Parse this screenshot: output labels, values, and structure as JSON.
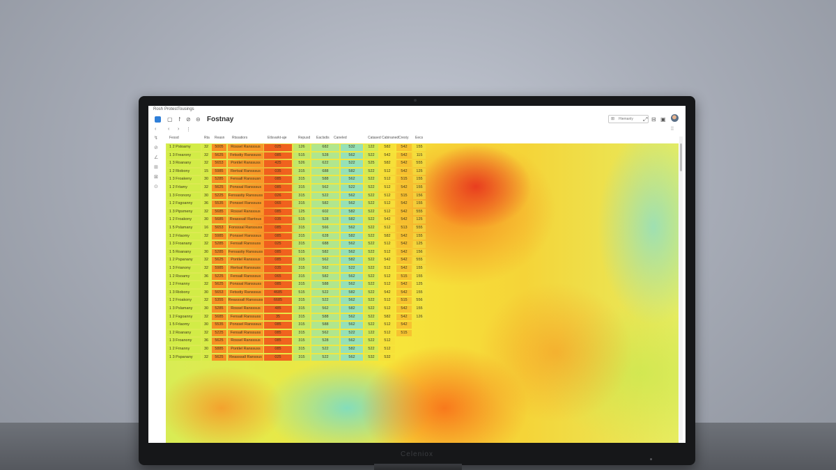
{
  "menubar": {
    "items": [
      "Rosh",
      "Protest",
      "Tousings"
    ]
  },
  "toolbar": {
    "app_title": "Fostnay",
    "search_label": "Hiemanly",
    "icons": [
      "app-icon",
      "square-icon",
      "history-icon",
      "undo-icon",
      "redo-icon",
      "grid-icon",
      "bar-icon",
      "edit-icon",
      "window-icon",
      "avatar"
    ]
  },
  "table": {
    "headers": [
      "Fessd",
      "Rta",
      "Reasn",
      "Rtssatiors",
      "Etlsvarkt-aje",
      "Repusd",
      "Eaclsdis",
      "Caneled",
      "Catased",
      "Cabinaned",
      "Cresty",
      "Eecs"
    ],
    "rows": [
      {
        "label": "1 2 Pstoamy",
        "n": "32",
        "code": "5005",
        "name": "Rossel Ransssus",
        "v": "025",
        "a": "126",
        "b": "682",
        "c": "532",
        "d": "122",
        "e": "582",
        "f": "542",
        "g": "155"
      },
      {
        "label": "1 3 Frearony",
        "n": "32",
        "code": "5625",
        "name": "Fetsstiy Ranssuss",
        "v": "085",
        "a": "515",
        "b": "528",
        "c": "562",
        "d": "522",
        "e": "542",
        "f": "542",
        "g": "115"
      },
      {
        "label": "1 3 Roanany",
        "n": "32",
        "code": "5653",
        "name": "Pontlel Ranssuss",
        "v": "425",
        "a": "526",
        "b": "622",
        "c": "522",
        "d": "525",
        "e": "582",
        "f": "542",
        "g": "555"
      },
      {
        "label": "1 2 Riobony",
        "n": "15",
        "code": "5985",
        "name": "Rertsal Ransssus",
        "v": "035",
        "a": "315",
        "b": "688",
        "c": "582",
        "d": "522",
        "e": "512",
        "f": "542",
        "g": "125"
      },
      {
        "label": "1 3 Froakeny",
        "n": "30",
        "code": "5285",
        "name": "Fensall Ranssusn",
        "v": "085",
        "a": "315",
        "b": "588",
        "c": "562",
        "d": "522",
        "e": "512",
        "f": "515",
        "g": "155"
      },
      {
        "label": "1 2 Frlamy",
        "n": "32",
        "code": "5625",
        "name": "Ponssal Ransssus",
        "v": "085",
        "a": "315",
        "b": "562",
        "c": "522",
        "d": "522",
        "e": "512",
        "f": "542",
        "g": "155"
      },
      {
        "label": "1 3 Frronony",
        "n": "30",
        "code": "5225",
        "name": "Fensastiy Ranssuss",
        "v": "026",
        "a": "315",
        "b": "522",
        "c": "562",
        "d": "522",
        "e": "512",
        "f": "515",
        "g": "156"
      },
      {
        "label": "1 2 Fsgoanny",
        "n": "36",
        "code": "5535",
        "name": "Ponssel Ranssuss",
        "v": "065",
        "a": "315",
        "b": "582",
        "c": "562",
        "d": "522",
        "e": "512",
        "f": "542",
        "g": "155"
      },
      {
        "label": "1 3 Pipsmeny",
        "n": "32",
        "code": "5685",
        "name": "Rossel Ransssus",
        "v": "085",
        "a": "125",
        "b": "602",
        "c": "582",
        "d": "522",
        "e": "512",
        "f": "542",
        "g": "555"
      },
      {
        "label": "1 2 Froakony",
        "n": "30",
        "code": "5685",
        "name": "Reasssall Rantsus",
        "v": "035",
        "a": "515",
        "b": "528",
        "c": "582",
        "d": "522",
        "e": "542",
        "f": "542",
        "g": "125"
      },
      {
        "label": "1 5 Pslamany",
        "n": "16",
        "code": "5653",
        "name": "Fonsssal Ranssuss",
        "v": "085",
        "a": "315",
        "b": "566",
        "c": "562",
        "d": "522",
        "e": "512",
        "f": "513",
        "g": "555"
      },
      {
        "label": "1 2 Frlaomy",
        "n": "32",
        "code": "5985",
        "name": "Ponssel Ransssus",
        "v": "085",
        "a": "315",
        "b": "628",
        "c": "582",
        "d": "522",
        "e": "582",
        "f": "542",
        "g": "155"
      },
      {
        "label": "1 3 Froanany",
        "n": "32",
        "code": "5285",
        "name": "Fensall Ranssuss",
        "v": "025",
        "a": "315",
        "b": "688",
        "c": "562",
        "d": "522",
        "e": "512",
        "f": "542",
        "g": "125"
      },
      {
        "label": "1 5 Roanany",
        "n": "30",
        "code": "5285",
        "name": "Fensastiy Ranssuss",
        "v": "085",
        "a": "515",
        "b": "582",
        "c": "562",
        "d": "522",
        "e": "512",
        "f": "542",
        "g": "156"
      },
      {
        "label": "1 2 Pspanany",
        "n": "32",
        "code": "5625",
        "name": "Pontlel Ransssus",
        "v": "085",
        "a": "315",
        "b": "562",
        "c": "582",
        "d": "522",
        "e": "542",
        "f": "542",
        "g": "555"
      },
      {
        "label": "1 3 Frianony",
        "n": "32",
        "code": "5985",
        "name": "Rertsal Ranssuss",
        "v": "035",
        "a": "315",
        "b": "562",
        "c": "522",
        "d": "522",
        "e": "512",
        "f": "542",
        "g": "155"
      },
      {
        "label": "1 2 Rsoamy",
        "n": "36",
        "code": "5225",
        "name": "Fensall Ransssus",
        "v": "065",
        "a": "315",
        "b": "582",
        "c": "562",
        "d": "522",
        "e": "512",
        "f": "515",
        "g": "155"
      },
      {
        "label": "1 2 Frnanny",
        "n": "32",
        "code": "5625",
        "name": "Ponssal Ranssuss",
        "v": "085",
        "a": "315",
        "b": "588",
        "c": "562",
        "d": "522",
        "e": "512",
        "f": "542",
        "g": "125"
      },
      {
        "label": "1 3 Riobony",
        "n": "30",
        "code": "5653",
        "name": "Fetsstiy Ransssus",
        "v": "4685",
        "a": "515",
        "b": "522",
        "c": "582",
        "d": "522",
        "e": "542",
        "f": "542",
        "g": "155"
      },
      {
        "label": "1 2 Froakony",
        "n": "32",
        "code": "5355",
        "name": "Reasssall Ranssuss",
        "v": "6685",
        "a": "315",
        "b": "522",
        "c": "562",
        "d": "522",
        "e": "512",
        "f": "515",
        "g": "556"
      },
      {
        "label": "1 3 Pslamany",
        "n": "30",
        "code": "5285",
        "name": "Rossel Ransssus",
        "v": "485",
        "a": "315",
        "b": "562",
        "c": "582",
        "d": "522",
        "e": "512",
        "f": "542",
        "g": "155"
      },
      {
        "label": "1 2 Fsgoanny",
        "n": "32",
        "code": "5685",
        "name": "Fensall Ranssuss",
        "v": "35",
        "a": "315",
        "b": "588",
        "c": "562",
        "d": "522",
        "e": "582",
        "f": "542",
        "g": "126"
      },
      {
        "label": "1 5 Frlaomy",
        "n": "30",
        "code": "5535",
        "name": "Ponssel Ransssus",
        "v": "085",
        "a": "315",
        "b": "588",
        "c": "562",
        "d": "522",
        "e": "512",
        "f": "542",
        "g": ""
      },
      {
        "label": "1 2 Roanany",
        "n": "32",
        "code": "5225",
        "name": "Fensall Ranssuss",
        "v": "085",
        "a": "315",
        "b": "562",
        "c": "522",
        "d": "122",
        "e": "512",
        "f": "515",
        "g": ""
      },
      {
        "label": "1 3 Froanony",
        "n": "36",
        "code": "5625",
        "name": "Rossel Ransssus",
        "v": "085",
        "a": "315",
        "b": "528",
        "c": "562",
        "d": "522",
        "e": "512",
        "f": "",
        "g": ""
      },
      {
        "label": "1 2 Frnanny",
        "n": "30",
        "code": "5885",
        "name": "Pontlel Ranssuss",
        "v": "085",
        "a": "315",
        "b": "522",
        "c": "582",
        "d": "522",
        "e": "512",
        "f": "",
        "g": ""
      },
      {
        "label": "1 3 Pspanany",
        "n": "32",
        "code": "5625",
        "name": "Reasssall Ranssus",
        "v": "025",
        "a": "315",
        "b": "522",
        "c": "562",
        "d": "532",
        "e": "532",
        "f": "",
        "g": ""
      }
    ]
  },
  "monitor": {
    "brand": "Celeniox"
  },
  "colors": {
    "heat_red": "#e8381e",
    "heat_orange": "#f7941e",
    "heat_yellow": "#f7e53a",
    "heat_green": "#c8e84f",
    "heat_cyan": "#8edec8",
    "accent_blue": "#2f7fd8"
  }
}
